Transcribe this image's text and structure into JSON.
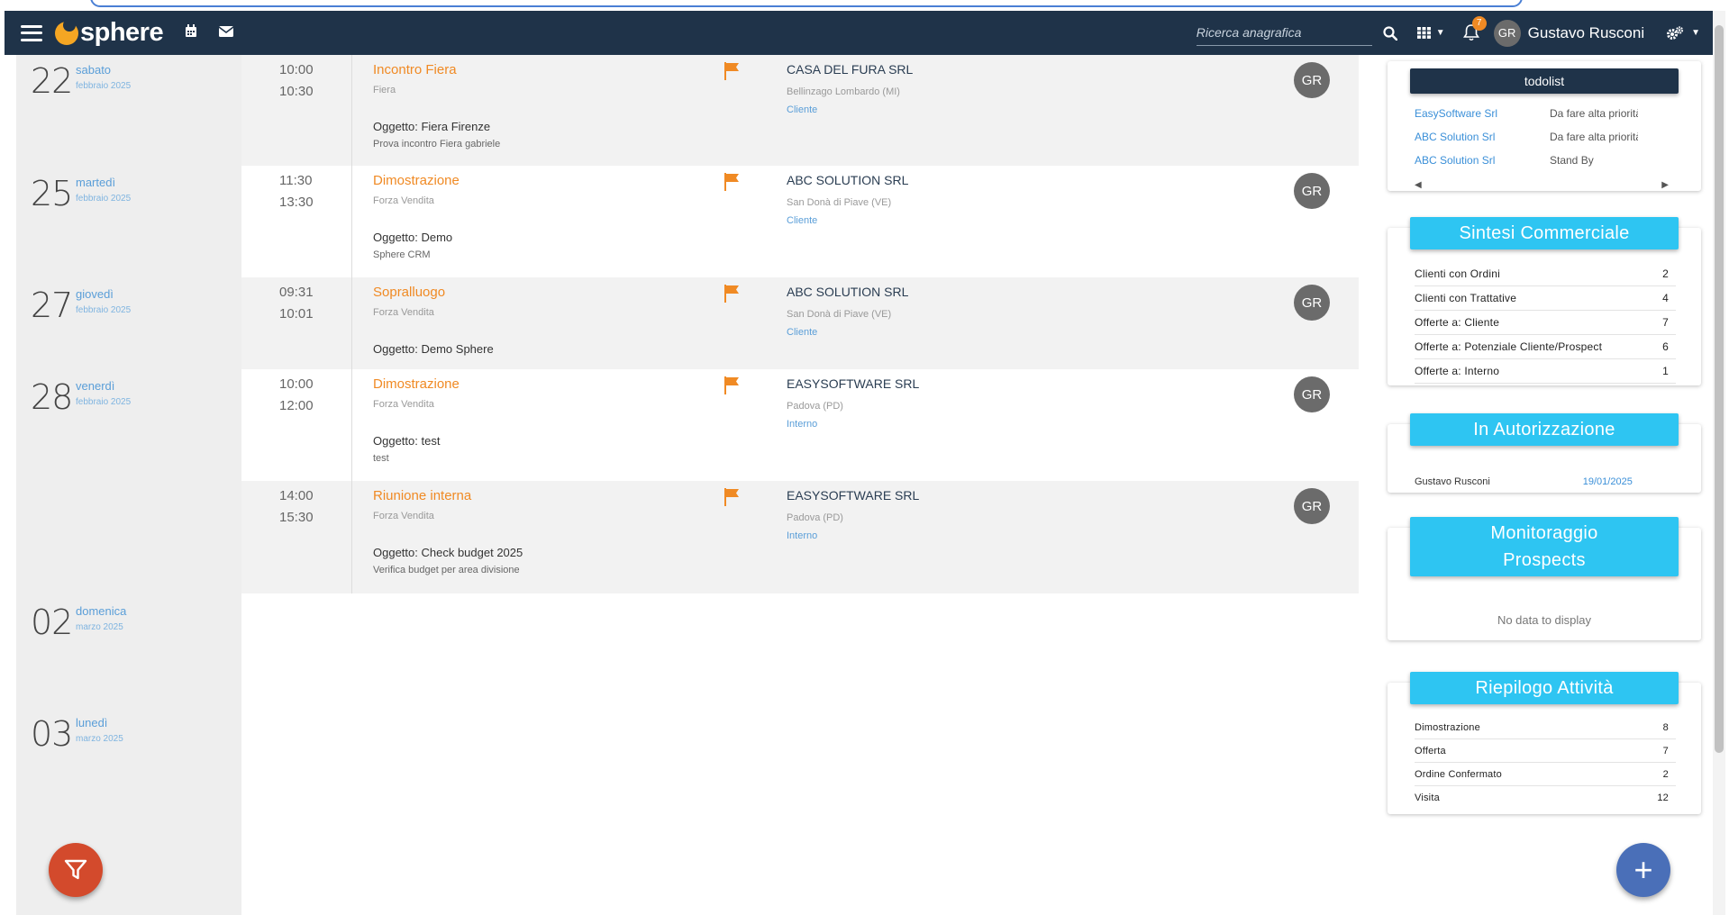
{
  "app": {
    "logo_text": "sphere",
    "brand_color": "#1f3349",
    "accent_color": "#2ec5f2",
    "orange_color": "#f08a24"
  },
  "navbar": {
    "search_placeholder": "Ricerca anagrafica",
    "notification_count": "7",
    "user_initials": "GR",
    "user_name": "Gustavo Rusconi"
  },
  "days": [
    {
      "num": "22",
      "name": "sabato",
      "month": "febbraio 2025"
    },
    {
      "num": "25",
      "name": "martedì",
      "month": "febbraio 2025"
    },
    {
      "num": "27",
      "name": "giovedì",
      "month": "febbraio 2025"
    },
    {
      "num": "28",
      "name": "venerdì",
      "month": "febbraio 2025"
    },
    {
      "num": "02",
      "name": "domenica",
      "month": "marzo 2025"
    },
    {
      "num": "03",
      "name": "lunedì",
      "month": "marzo 2025"
    }
  ],
  "events": [
    {
      "start": "10:00",
      "end": "10:30",
      "title": "Incontro Fiera",
      "type": "Fiera",
      "subject": "Oggetto: Fiera Firenze",
      "desc": "Prova incontro Fiera gabriele",
      "company": "CASA DEL FURA SRL",
      "city": "Bellinzago Lombardo (MI)",
      "role": "Cliente",
      "avatar": "GR"
    },
    {
      "start": "11:30",
      "end": "13:30",
      "title": "Dimostrazione",
      "type": "Forza Vendita",
      "subject": "Oggetto: Demo",
      "desc": "Sphere CRM",
      "company": "ABC SOLUTION SRL",
      "city": "San Donà di Piave (VE)",
      "role": "Cliente",
      "avatar": "GR"
    },
    {
      "start": "09:31",
      "end": "10:01",
      "title": "Sopralluogo",
      "type": "Forza Vendita",
      "subject": "Oggetto: Demo Sphere",
      "desc": "",
      "company": "ABC SOLUTION SRL",
      "city": "San Donà di Piave (VE)",
      "role": "Cliente",
      "avatar": "GR"
    },
    {
      "start": "10:00",
      "end": "12:00",
      "title": "Dimostrazione",
      "type": "Forza Vendita",
      "subject": "Oggetto: test",
      "desc": "test",
      "company": "EASYSOFTWARE SRL",
      "city": "Padova (PD)",
      "role": "Interno",
      "avatar": "GR"
    },
    {
      "start": "14:00",
      "end": "15:30",
      "title": "Riunione interna",
      "type": "Forza Vendita",
      "subject": "Oggetto: Check budget 2025",
      "desc": "Verifica budget per area divisione",
      "company": "EASYSOFTWARE SRL",
      "city": "Padova (PD)",
      "role": "Interno",
      "avatar": "GR"
    }
  ],
  "todolist": {
    "title": "todolist",
    "rows": [
      {
        "company": "EasySoftware Srl",
        "status": "Da fare alta priorità"
      },
      {
        "company": "ABC Solution Srl",
        "status": "Da fare alta priorità"
      },
      {
        "company": "ABC Solution Srl",
        "status": "Stand By"
      }
    ]
  },
  "sintesi": {
    "title": "Sintesi Commerciale",
    "rows": [
      {
        "label": "Clienti con Ordini",
        "value": "2"
      },
      {
        "label": "Clienti con Trattative",
        "value": "4"
      },
      {
        "label": "Offerte a: Cliente",
        "value": "7"
      },
      {
        "label": "Offerte a: Potenziale Cliente/Prospect",
        "value": "6"
      },
      {
        "label": "Offerte a: Interno",
        "value": "1"
      }
    ]
  },
  "autorizzazione": {
    "title": "In Autorizzazione",
    "name": "Gustavo Rusconi",
    "date": "19/01/2025"
  },
  "monitoraggio": {
    "title_line1": "Monitoraggio",
    "title_line2": "Prospects",
    "empty": "No data to display"
  },
  "riepilogo": {
    "title": "Riepilogo Attività",
    "rows": [
      {
        "label": "Dimostrazione",
        "value": "8"
      },
      {
        "label": "Offerta",
        "value": "7"
      },
      {
        "label": "Ordine Confermato",
        "value": "2"
      },
      {
        "label": "Visita",
        "value": "12"
      }
    ]
  }
}
